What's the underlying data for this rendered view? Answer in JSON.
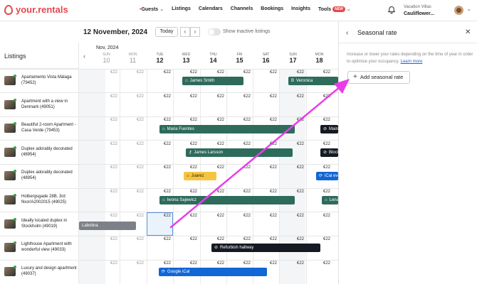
{
  "brand": {
    "name": "your.rentals"
  },
  "nav": [
    {
      "label": "Guests",
      "caret": true
    },
    {
      "label": "Listings"
    },
    {
      "label": "Calendars"
    },
    {
      "label": "Channels"
    },
    {
      "label": "Bookings"
    },
    {
      "label": "Insights"
    },
    {
      "label": "Tools",
      "badge": "NEW",
      "caret": true
    }
  ],
  "user": {
    "org": "Vacation Villas",
    "name": "Cauliflower..."
  },
  "toolbar": {
    "date": "12 November, 2024",
    "today": "Today",
    "prev": "‹",
    "next": "›",
    "show_inactive": "Show inactive listings"
  },
  "listings_title": "Listings",
  "month": "Nov, 2024",
  "days": [
    {
      "dn": "SUN",
      "dd": "10",
      "past": true
    },
    {
      "dn": "MON",
      "dd": "11",
      "past": true
    },
    {
      "dn": "TUE",
      "dd": "12"
    },
    {
      "dn": "WED",
      "dd": "13"
    },
    {
      "dn": "THU",
      "dd": "14"
    },
    {
      "dn": "FRI",
      "dd": "15"
    },
    {
      "dn": "SAT",
      "dd": "16"
    },
    {
      "dn": "SUN",
      "dd": "17"
    },
    {
      "dn": "MON",
      "dd": "18"
    }
  ],
  "price_label": "€22",
  "listings": [
    "Apartamento Vista Málaga (79452)",
    "Apartment with a view in Denmark (49051)",
    "Beautiful 2-room Apartment - Casa Verde (79453)",
    "Duplex adorably decorated (48954)",
    "Duplex adorably decorated (48954)",
    "Holbergsgade 28B, 3rd floor/A2002015 (49025)",
    "Ideally located duplex in Stockholm (49019)",
    "Lighthouse Apartment with wonderful view (49033)",
    "Luxury and design apartment (49037)"
  ],
  "bookings": [
    {
      "label": "James Smith",
      "color": "#2e6b5b"
    },
    {
      "label": "Veronica",
      "color": "#2e6b5b"
    },
    {
      "label": "Maria Fuentes",
      "color": "#2e6b5b"
    },
    {
      "label": "Maint",
      "color": "#151a22"
    },
    {
      "label": "James Larsson",
      "color": "#2e6b5b"
    },
    {
      "label": "Block",
      "color": "#151a22"
    },
    {
      "label": "Juarez",
      "color": "#f5c542"
    },
    {
      "label": "iCal eve",
      "color": "#1266d6"
    },
    {
      "label": "Iwona Sajewicz",
      "color": "#2e6b5b"
    },
    {
      "label": "Lena",
      "color": "#2e6b5b"
    },
    {
      "label": "Labolina",
      "color": "#7d8187"
    },
    {
      "label": "Refurbish hallway",
      "color": "#151a22"
    },
    {
      "label": "Google iCal",
      "color": "#1266d6"
    }
  ],
  "panel": {
    "title": "Seasonal rate",
    "description": "Increase or lower your rates depending on the time of year in order to optimise your occupancy.",
    "learn_more": "Learn more",
    "add_button": "Add seasonal rate"
  },
  "colors": {
    "brand": "#e5484d",
    "annotation_arrow": "#e83ee8"
  }
}
